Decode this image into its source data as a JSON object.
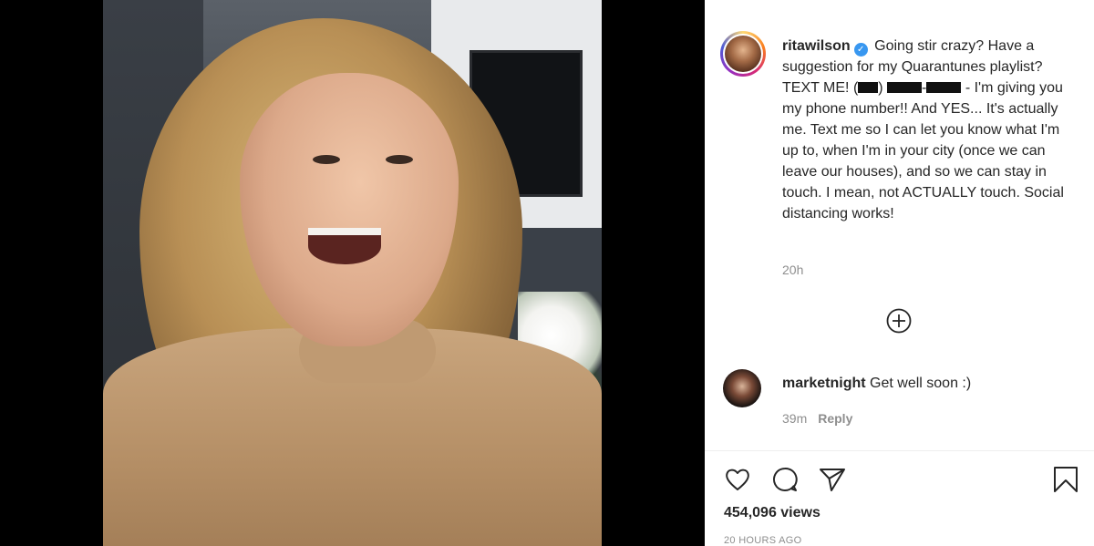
{
  "post": {
    "username": "ritawilson",
    "caption_part1": "Going stir crazy? Have a suggestion for my Quarantunes playlist? TEXT ME! (",
    "caption_part2": ") ",
    "caption_part3": "-",
    "caption_part4": " - I'm giving you my phone number!! And YES... It's actually me. Text me so I can let you know what I'm up to, when I'm in your city (once we can leave our houses), and so we can stay in touch. I mean, not ACTUALLY touch. Social distancing works!",
    "time_ago": "20h"
  },
  "comments": [
    {
      "username": "marketnight",
      "text": "Get well soon :)",
      "time_ago": "39m",
      "reply_label": "Reply"
    }
  ],
  "stats": {
    "views": "454,096 views",
    "date": "20 HOURS AGO"
  },
  "icons": {
    "like": "heart-icon",
    "comment": "comment-icon",
    "share": "paper-plane-icon",
    "save": "bookmark-icon",
    "load_more": "plus-circle-icon",
    "verified": "verified-badge-icon"
  },
  "colors": {
    "verified": "#3897f0",
    "text": "#262626",
    "muted": "#8e8e8e"
  }
}
